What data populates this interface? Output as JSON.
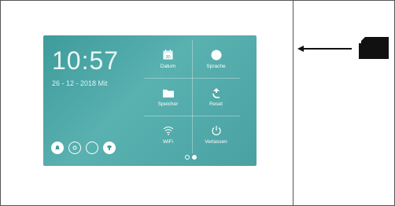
{
  "screen": {
    "time": "10:57",
    "date": "26 - 12 - 2018 Mit",
    "tiles": [
      {
        "label": "Datum",
        "icon": "calendar-icon",
        "number": "30"
      },
      {
        "label": "Sprache",
        "icon": "language-icon"
      },
      {
        "label": "Speicher",
        "icon": "folder-icon"
      },
      {
        "label": "Reset",
        "icon": "reset-icon"
      },
      {
        "label": "WiFi",
        "icon": "wifi-icon"
      },
      {
        "label": "Verlassen",
        "icon": "power-icon"
      }
    ],
    "bottom_icons": [
      "bell-icon",
      "camera-icon",
      "circle-icon",
      "shirt-icon"
    ],
    "page_dots": 2,
    "active_page": 2
  },
  "colors": {
    "screen": "#4aa7a7",
    "foreground": "#ffffff"
  }
}
